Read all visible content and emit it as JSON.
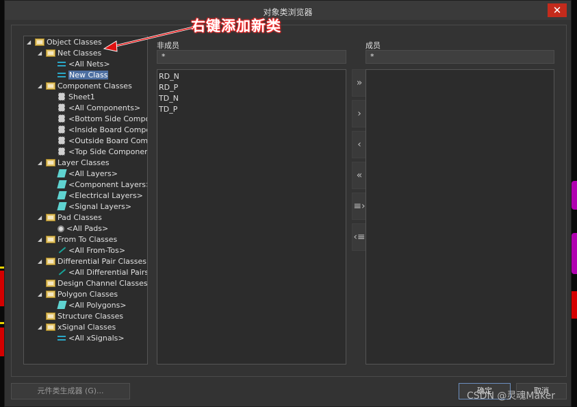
{
  "window": {
    "title": "对象类浏览器",
    "close_glyph": "✕"
  },
  "annotation": "右键添加新类",
  "tree": {
    "items": [
      {
        "label": "Object Classes",
        "icon": "object-classes-folder-icon",
        "level": 0,
        "expanded": true
      },
      {
        "label": "Net Classes",
        "icon": "net-classes-folder-icon",
        "level": 1,
        "expanded": true
      },
      {
        "label": "<All Nets>",
        "icon": "net-icon",
        "level": 2
      },
      {
        "label": "New Class",
        "icon": "net-icon",
        "level": 2,
        "selected": true
      },
      {
        "label": "Component Classes",
        "icon": "component-classes-folder-icon",
        "level": 1,
        "expanded": true
      },
      {
        "label": "Sheet1",
        "icon": "component-icon",
        "level": 2
      },
      {
        "label": "<All Components>",
        "icon": "component-icon",
        "level": 2
      },
      {
        "label": "<Bottom Side Components>",
        "icon": "component-icon",
        "level": 2
      },
      {
        "label": "<Inside Board Components>",
        "icon": "component-icon",
        "level": 2
      },
      {
        "label": "<Outside Board Components>",
        "icon": "component-icon",
        "level": 2
      },
      {
        "label": "<Top Side Components>",
        "icon": "component-icon",
        "level": 2
      },
      {
        "label": "Layer Classes",
        "icon": "layer-classes-folder-icon",
        "level": 1,
        "expanded": true
      },
      {
        "label": "<All Layers>",
        "icon": "layer-icon",
        "level": 2
      },
      {
        "label": "<Component Layers>",
        "icon": "layer-icon",
        "level": 2
      },
      {
        "label": "<Electrical Layers>",
        "icon": "layer-icon",
        "level": 2
      },
      {
        "label": "<Signal Layers>",
        "icon": "layer-icon",
        "level": 2
      },
      {
        "label": "Pad Classes",
        "icon": "pad-classes-folder-icon",
        "level": 1,
        "expanded": true
      },
      {
        "label": "<All Pads>",
        "icon": "pad-icon",
        "level": 2
      },
      {
        "label": "From To Classes",
        "icon": "from-to-classes-folder-icon",
        "level": 1,
        "expanded": true
      },
      {
        "label": "<All From-Tos>",
        "icon": "from-to-icon",
        "level": 2
      },
      {
        "label": "Differential Pair Classes",
        "icon": "differential-pair-classes-folder-icon",
        "level": 1,
        "expanded": true
      },
      {
        "label": "<All Differential Pairs>",
        "icon": "from-to-icon",
        "level": 2
      },
      {
        "label": "Design Channel Classes",
        "icon": "design-channel-classes-folder-icon",
        "level": 1,
        "expanded": false
      },
      {
        "label": "Polygon Classes",
        "icon": "polygon-classes-folder-icon",
        "level": 1,
        "expanded": true
      },
      {
        "label": "<All Polygons>",
        "icon": "layer-icon",
        "level": 2
      },
      {
        "label": "Structure Classes",
        "icon": "structure-classes-folder-icon",
        "level": 1,
        "expanded": false
      },
      {
        "label": "xSignal Classes",
        "icon": "xsignal-classes-folder-icon",
        "level": 1,
        "expanded": true
      },
      {
        "label": "<All xSignals>",
        "icon": "net-icon",
        "level": 2
      }
    ]
  },
  "non_members": {
    "label": "非成员",
    "filter": "*",
    "items": [
      "RD_N",
      "RD_P",
      "TD_N",
      "TD_P"
    ]
  },
  "members": {
    "label": "成员",
    "filter": "*",
    "items": []
  },
  "move_buttons": [
    {
      "glyph": "»",
      "name": "move-all-right-button"
    },
    {
      "glyph": "›",
      "name": "move-right-button"
    },
    {
      "glyph": "‹",
      "name": "move-left-button"
    },
    {
      "glyph": "«",
      "name": "move-all-left-button"
    },
    {
      "glyph": "≡›",
      "name": "move-selected-right-button"
    },
    {
      "glyph": "‹≡",
      "name": "move-selected-left-button"
    }
  ],
  "footer": {
    "generator_label": "元件类生成器 (G)...",
    "ok_label": "确定",
    "cancel_label": "取消"
  },
  "watermark": "CSDN @灵魂Maker",
  "colors": {
    "accent_red": "#c42b1c",
    "selection": "#4d6fa1",
    "annotation_outline": "#e01010"
  }
}
